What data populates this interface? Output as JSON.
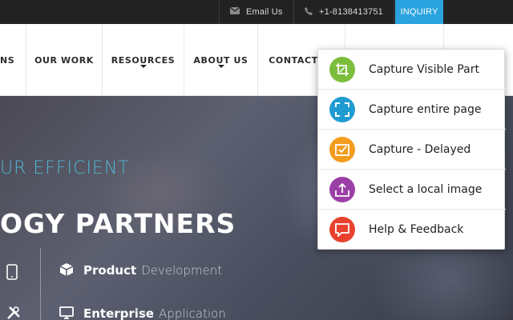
{
  "topbar": {
    "email_label": "Email Us",
    "phone_label": "+1-8138413751",
    "inquiry_label": "INQUIRY"
  },
  "nav": {
    "items": [
      {
        "label": "NS"
      },
      {
        "label": "OUR WORK"
      },
      {
        "label": "RESOURCES"
      },
      {
        "label": "ABOUT US"
      },
      {
        "label": "CONTACT"
      }
    ]
  },
  "hero": {
    "tagline": "UR EFFICIENT",
    "headline": "OGY PARTNERS",
    "services": [
      {
        "bold": "Product",
        "rest": "Development"
      },
      {
        "bold": "Enterprise",
        "rest": "Application"
      }
    ]
  },
  "popup": {
    "items": [
      {
        "label": "Capture Visible Part",
        "color": "#7cbd3c",
        "icon": "crop-icon"
      },
      {
        "label": "Capture entire page",
        "color": "#1f9bd1",
        "icon": "fullscreen-icon"
      },
      {
        "label": "Capture - Delayed",
        "color": "#f39c1d",
        "icon": "delayed-check-icon"
      },
      {
        "label": "Select a local image",
        "color": "#9b3fa6",
        "icon": "upload-icon"
      },
      {
        "label": "Help & Feedback",
        "color": "#e8422f",
        "icon": "feedback-icon"
      }
    ]
  },
  "colors": {
    "accent": "#2aa3e0",
    "topbar_bg": "#222222",
    "tagline": "#4fb6cf"
  }
}
